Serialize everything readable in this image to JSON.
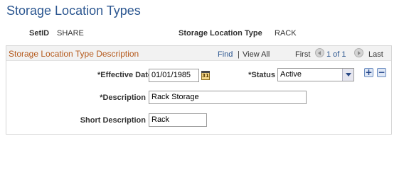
{
  "page": {
    "title": "Storage Location Types"
  },
  "keys": {
    "setid_label": "SetID",
    "setid_value": "SHARE",
    "type_label": "Storage Location Type",
    "type_value": "RACK"
  },
  "group": {
    "title": "Storage Location Type Description",
    "nav": {
      "find": "Find",
      "separator": "|",
      "view_all": "View All",
      "first": "First",
      "range": "1 of 1",
      "last": "Last"
    }
  },
  "form": {
    "effective_date_label": "Effective Date",
    "effective_date_value": "01/01/1985",
    "calendar_icon_text": "31",
    "status_label": "Status",
    "status_value": "Active",
    "description_label": "Description",
    "description_value": "Rack Storage",
    "short_description_label": "Short Description",
    "short_description_value": "Rack",
    "required_marker": "*",
    "add_row_symbol": "+",
    "delete_row_symbol": "−"
  },
  "colors": {
    "title": "#2b5690",
    "group_title": "#b5591b",
    "link": "#2b5690"
  },
  "icons": {
    "calendar": "calendar-icon",
    "prev": "previous-arrow-icon",
    "next": "next-arrow-icon",
    "dropdown": "chevron-down-icon"
  }
}
